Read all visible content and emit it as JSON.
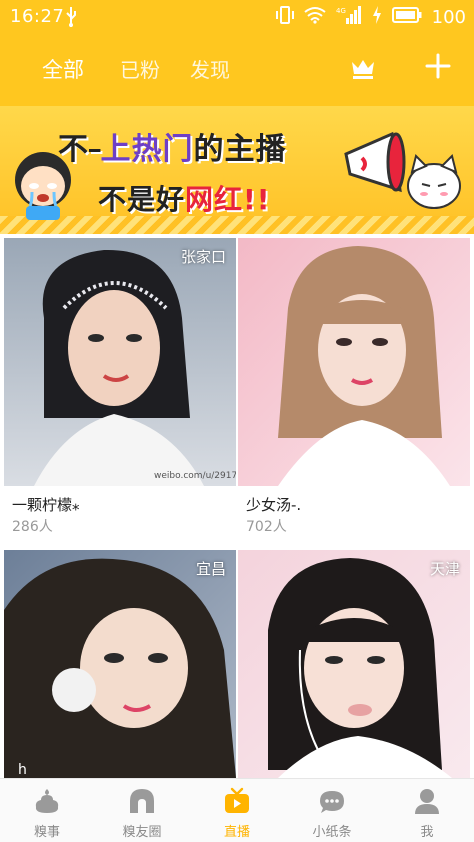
{
  "status_bar": {
    "time": "16:27",
    "battery": "100",
    "signal_label": "4G"
  },
  "header": {
    "tabs": [
      {
        "label": "全部",
        "active": true
      },
      {
        "label": "已粉",
        "active": false
      },
      {
        "label": "发现",
        "active": false
      }
    ],
    "icons": [
      "crown-icon",
      "plus-icon"
    ]
  },
  "banner": {
    "line1_part1": "不",
    "line1_part2": "上热门",
    "line1_part3": "的主播",
    "line2_part1": "不是好",
    "line2_part2": "网红",
    "line2_part3": "!!"
  },
  "streams": [
    {
      "city": "张家口",
      "name": "一颗柠檬⁎",
      "count": "286人"
    },
    {
      "city": "",
      "name": "少女汤-.",
      "count": "702人"
    },
    {
      "city": "宜昌",
      "name": "",
      "count": ""
    },
    {
      "city": "天津",
      "name": "",
      "count": ""
    }
  ],
  "bottom_nav": [
    {
      "label": "糗事",
      "icon": "poop-icon",
      "active": false
    },
    {
      "label": "糗友圈",
      "icon": "bubble-arch-icon",
      "active": false
    },
    {
      "label": "直播",
      "icon": "tv-play-icon",
      "active": true
    },
    {
      "label": "小纸条",
      "icon": "chat-icon",
      "active": false
    },
    {
      "label": "我",
      "icon": "person-icon",
      "active": false
    }
  ],
  "colors": {
    "primary": "#FFC71F",
    "active_tab": "#FFB400",
    "inactive_tab": "#8a8a8a"
  }
}
